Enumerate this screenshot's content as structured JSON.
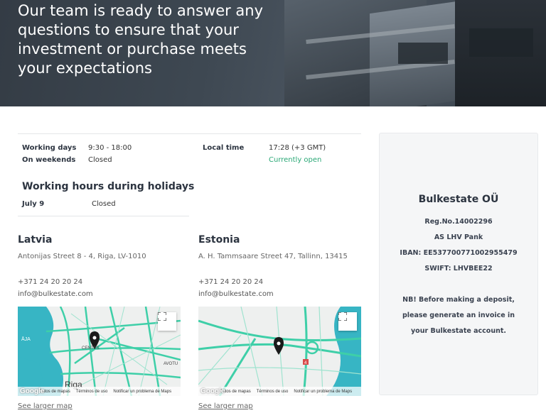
{
  "hero": {
    "lines": [
      "Our team is ready to answer any",
      "questions to ensure that your",
      "investment or purchase meets",
      "your expectations"
    ]
  },
  "hours": {
    "working_days_label": "Working days",
    "working_days_value": "9:30 - 18:00",
    "weekends_label": "On weekends",
    "weekends_value": "Closed",
    "local_time_label": "Local time",
    "local_time_value": "17:28 (+3 GMT)",
    "status": "Currently open",
    "holidays_title": "Working hours during holidays",
    "holiday_date": "July 9",
    "holiday_value": "Closed"
  },
  "offices": [
    {
      "country": "Latvia",
      "address": "Antonijas Street 8 - 4, Riga, LV-1010",
      "phone": "+371 24 20 20 24",
      "email": "info@bulkestate.com",
      "map_labels": {
        "city": "Riga",
        "center": "CENTRS",
        "street": "AVOTU",
        "lake": "ĀJA"
      },
      "larger_map": "See larger map"
    },
    {
      "country": "Estonia",
      "address": "A. H. Tammsaare Street 47, Tallinn, 13415",
      "phone": "+371 24 20 20 24",
      "email": "info@bulkestate.com",
      "map_labels": {
        "road": "4"
      },
      "larger_map": "See larger map"
    }
  ],
  "map_attribution": {
    "google": "Google",
    "data": "Datos de mapas",
    "terms": "Términos de uso",
    "report": "Notificar un problema de Maps"
  },
  "company": {
    "name": "Bulkestate OÜ",
    "reg": "Reg.No.14002296",
    "bank": "AS LHV Pank",
    "iban": "IBAN: EE537700771002955479",
    "swift": "SWIFT: LHVBEE22",
    "note_1": "NB! Before making a deposit,",
    "note_2": "please generate an invoice in",
    "note_3": "your Bulkestate account."
  },
  "colors": {
    "accent_green": "#2aa876",
    "map_road": "#3ecfa8",
    "map_water": "#37b5c4"
  }
}
